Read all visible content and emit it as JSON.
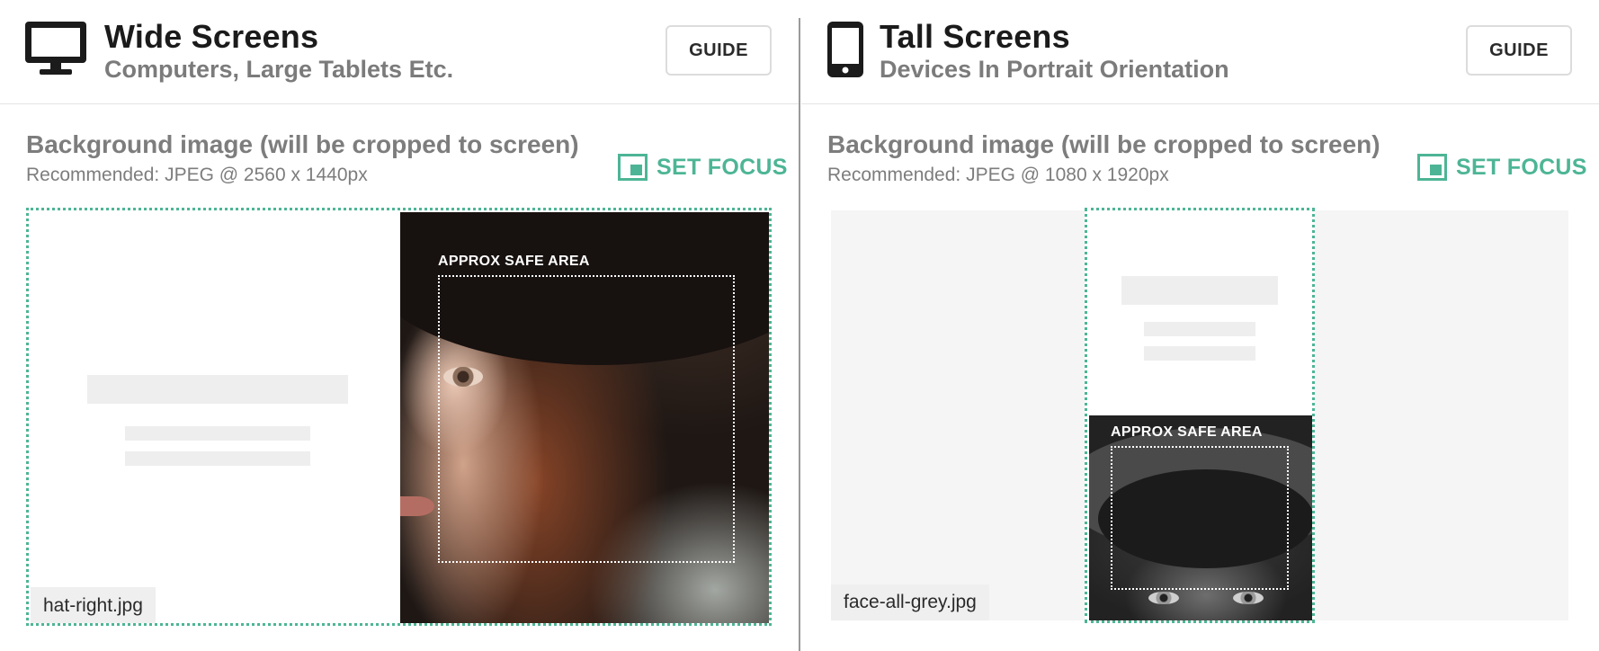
{
  "wide": {
    "icon": "monitor-icon",
    "title": "Wide Screens",
    "subtitle": "Computers, Large Tablets Etc.",
    "guide_label": "GUIDE",
    "bg_heading": "Background image (will be cropped to screen)",
    "bg_recommended": "Recommended: JPEG @ 2560 x 1440px",
    "set_focus_label": "SET FOCUS",
    "safe_area_label": "APPROX SAFE AREA",
    "filename": "hat-right.jpg"
  },
  "tall": {
    "icon": "phone-icon",
    "title": "Tall Screens",
    "subtitle": "Devices In Portrait Orientation",
    "guide_label": "GUIDE",
    "bg_heading": "Background image (will be cropped to screen)",
    "bg_recommended": "Recommended: JPEG @ 1080 x 1920px",
    "set_focus_label": "SET FOCUS",
    "safe_area_label": "APPROX SAFE AREA",
    "filename": "face-all-grey.jpg"
  },
  "colors": {
    "accent": "#4db595",
    "title": "#1b1b1b",
    "muted": "#7b7b7b",
    "placeholder": "#eeeeee"
  }
}
